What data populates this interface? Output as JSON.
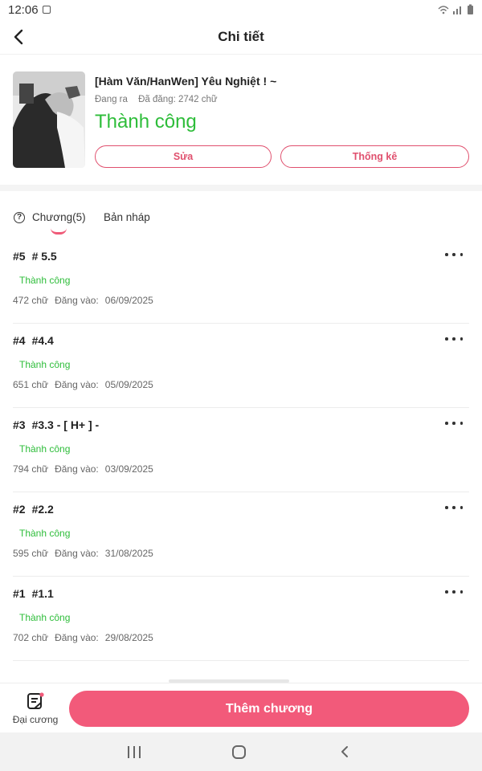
{
  "status_bar": {
    "time": "12:06"
  },
  "header": {
    "title": "Chi tiết"
  },
  "book": {
    "title": "[Hàm Văn/HanWen] Yêu Nghiệt ! ~",
    "state": "Đang ra",
    "published_words": "Đã đăng: 2742 chữ",
    "status": "Thành công",
    "edit_label": "Sửa",
    "stats_label": "Thống kê"
  },
  "tabs": {
    "chapters_label": "Chương(5)",
    "drafts_label": "Bản nháp"
  },
  "chapters": [
    {
      "number": "#5",
      "title": "# 5.5",
      "status": "Thành công",
      "words": "472 chữ",
      "posted_label": "Đăng vào:",
      "date": "06/09/2025"
    },
    {
      "number": "#4",
      "title": "#4.4",
      "status": "Thành công",
      "words": "651 chữ",
      "posted_label": "Đăng vào:",
      "date": "05/09/2025"
    },
    {
      "number": "#3",
      "title": "#3.3 - [ H+ ] -",
      "status": "Thành công",
      "words": "794 chữ",
      "posted_label": "Đăng vào:",
      "date": "03/09/2025"
    },
    {
      "number": "#2",
      "title": "#2.2",
      "status": "Thành công",
      "words": "595 chữ",
      "posted_label": "Đăng vào:",
      "date": "31/08/2025"
    },
    {
      "number": "#1",
      "title": "#1.1",
      "status": "Thành công",
      "words": "702 chữ",
      "posted_label": "Đăng vào:",
      "date": "29/08/2025"
    }
  ],
  "bottom": {
    "outline_label": "Đại cương",
    "add_chapter_label": "Thêm chương"
  },
  "colors": {
    "accent": "#f25a7a",
    "success": "#2ebd3a",
    "outline_pink": "#e0506e"
  }
}
